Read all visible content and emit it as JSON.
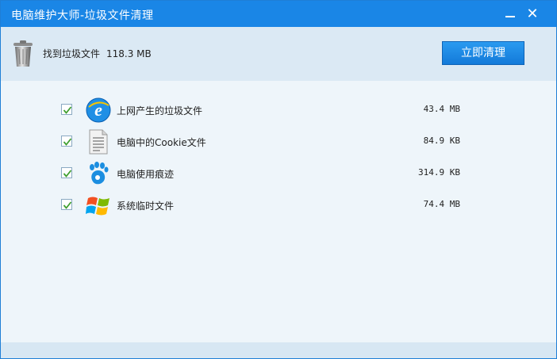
{
  "window": {
    "title": "电脑维护大师-垃圾文件清理",
    "minimize_icon": "minimize-icon",
    "close_icon": "close-icon",
    "close_glyph": "✕"
  },
  "header": {
    "found_label": "找到垃圾文件",
    "found_size": "118.3 MB",
    "clean_button": "立即清理",
    "trash_icon": "trash-can-icon"
  },
  "items": [
    {
      "label": "上网产生的垃圾文件",
      "value": "43.4 MB",
      "icon": "internet-explorer-icon",
      "checked": true
    },
    {
      "label": "电脑中的Cookie文件",
      "value": "84.9 KB",
      "icon": "document-icon",
      "checked": true
    },
    {
      "label": "电脑使用痕迹",
      "value": "314.9 KB",
      "icon": "gnome-foot-icon",
      "checked": true
    },
    {
      "label": "系统临时文件",
      "value": "74.4 MB",
      "icon": "windows-logo-icon",
      "checked": true
    }
  ],
  "colors": {
    "titlebar": "#1a86e6",
    "header_bg": "#dbe9f4",
    "list_bg": "#eef5fa",
    "button": "#137ad9",
    "check": "#3f9f2f"
  }
}
